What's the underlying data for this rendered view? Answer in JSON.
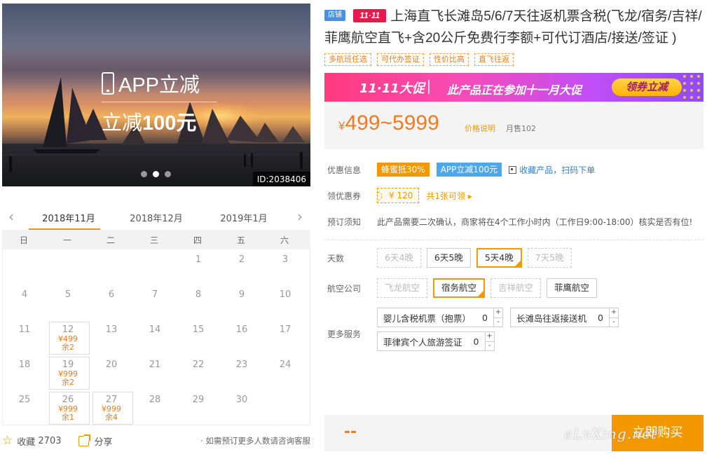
{
  "hero": {
    "promo_line1": "APP立减",
    "promo_line2_prefix": "立减",
    "promo_line2_amount": "100元",
    "id_text": "ID:2038406"
  },
  "calendar": {
    "months": [
      "2018年11月",
      "2018年12月",
      "2019年1月"
    ],
    "weekdays": [
      "日",
      "一",
      "二",
      "三",
      "四",
      "五",
      "六"
    ],
    "rows": [
      [
        {
          "d": ""
        },
        {
          "d": ""
        },
        {
          "d": ""
        },
        {
          "d": ""
        },
        {
          "d": "1"
        },
        {
          "d": "2"
        },
        {
          "d": "3"
        }
      ],
      [
        {
          "d": "4"
        },
        {
          "d": "5"
        },
        {
          "d": "6"
        },
        {
          "d": "7"
        },
        {
          "d": "8"
        },
        {
          "d": "9"
        },
        {
          "d": "10"
        }
      ],
      [
        {
          "d": "11"
        },
        {
          "d": "12",
          "price": "¥499",
          "left": "余2"
        },
        {
          "d": "13"
        },
        {
          "d": "14"
        },
        {
          "d": "15"
        },
        {
          "d": "16"
        },
        {
          "d": "17"
        }
      ],
      [
        {
          "d": "18"
        },
        {
          "d": "19",
          "price": "¥999",
          "left": "余2"
        },
        {
          "d": "20"
        },
        {
          "d": "21"
        },
        {
          "d": "22"
        },
        {
          "d": "23"
        },
        {
          "d": "24"
        }
      ],
      [
        {
          "d": "25"
        },
        {
          "d": "26",
          "price": "¥999",
          "left": "余1"
        },
        {
          "d": "27",
          "price": "¥999",
          "left": "余4"
        },
        {
          "d": "28"
        },
        {
          "d": "29"
        },
        {
          "d": "30"
        },
        {
          "d": ""
        }
      ]
    ]
  },
  "footer": {
    "favorite_label": "收藏",
    "favorite_count": "2703",
    "share_label": "分享",
    "note": "· 如需预订更多人数请咨询客服"
  },
  "product": {
    "shop_badge": "店铺",
    "promo_badge": "11·11",
    "title": "上海直飞长滩岛5/6/7天往返机票含税(飞龙/宿务/吉祥/菲鹰航空直飞+含20公斤免费行李额+可代订酒店/接送/签证 )",
    "tags": [
      "多航班任选",
      "可代办签证",
      "性价比高",
      "直飞往返"
    ]
  },
  "banner": {
    "logo": "11·11大促",
    "text": "此产品正在参加十一月大促",
    "button": "领券立减"
  },
  "price": {
    "currency": "¥",
    "range": "499~5999",
    "note": "价格说明",
    "sold": "月售102"
  },
  "info": {
    "discount_label": "优惠信息",
    "discount_tag1": "蜂蜜抵30%",
    "discount_tag2": "APP立减100元",
    "collect_text": "收藏产品，扫码下单",
    "coupon_label": "领优惠券",
    "coupon_value": "¥ 120",
    "coupon_more": "共1张可领",
    "notice_label": "预订须知",
    "notice_text": "此产品需要二次确认，商家将在4个工作小时内（工作日9:00-18:00）核实是否有位!"
  },
  "options": {
    "days_label": "天数",
    "days": [
      {
        "label": "6天4晚",
        "state": "disabled"
      },
      {
        "label": "6天5晚",
        "state": "normal"
      },
      {
        "label": "5天4晚",
        "state": "selected"
      },
      {
        "label": "7天5晚",
        "state": "disabled"
      }
    ],
    "airline_label": "航空公司",
    "airlines": [
      {
        "label": "飞龙航空",
        "state": "disabled"
      },
      {
        "label": "宿务航空",
        "state": "selected"
      },
      {
        "label": "吉祥航空",
        "state": "disabled"
      },
      {
        "label": "菲鹰航空",
        "state": "normal"
      }
    ],
    "services_label": "更多服务",
    "services": [
      {
        "name": "婴儿含税机票（抱票）",
        "qty": "0",
        "plus": "+",
        "minus": "-"
      },
      {
        "name": "长滩岛往返接送机",
        "qty": "0",
        "plus": "+",
        "minus": "-"
      },
      {
        "name": "菲律宾个人旅游签证",
        "qty": "0",
        "plus": "+",
        "minus": "-"
      }
    ]
  },
  "buy": {
    "total": "--",
    "button": "立即购买"
  },
  "watermark": "eLvXing.net",
  "colors": {
    "accent": "#f39800",
    "price": "#f37b1d",
    "link": "#2a7fd4"
  }
}
